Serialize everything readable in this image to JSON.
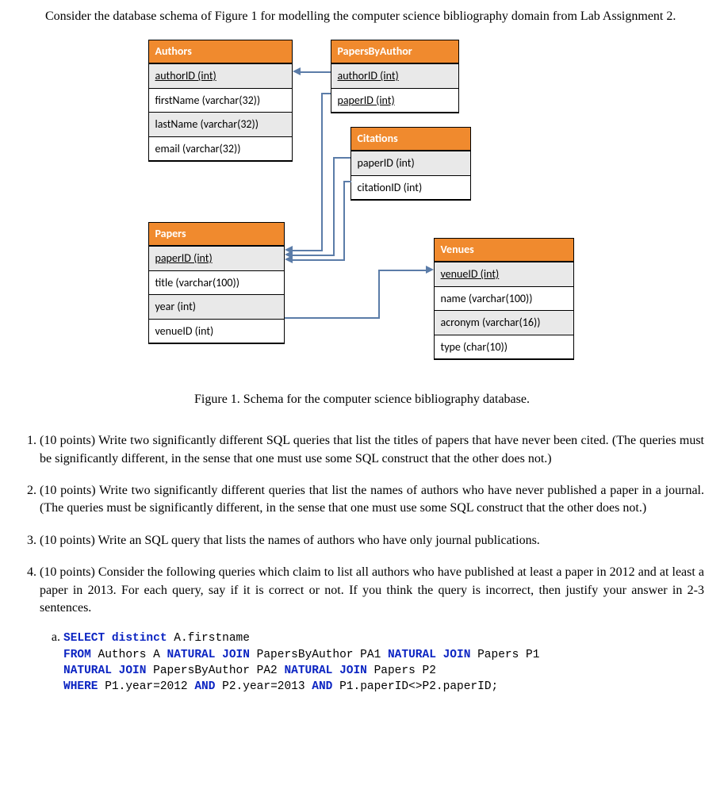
{
  "intro": "Consider the database schema of Figure 1 for modelling the computer science bibliography domain from Lab Assignment 2.",
  "schema": {
    "authors": {
      "title": "Authors",
      "cols": [
        "authorID (int)",
        "firstName (varchar(32))",
        "lastName (varchar(32))",
        "email (varchar(32))"
      ]
    },
    "papersByAuthor": {
      "title": "PapersByAuthor",
      "cols": [
        "authorID (int)",
        "paperID (int)"
      ]
    },
    "citations": {
      "title": "Citations",
      "cols": [
        "paperID (int)",
        "citationID (int)"
      ]
    },
    "papers": {
      "title": "Papers",
      "cols": [
        "paperID (int)",
        "title (varchar(100))",
        "year (int)",
        "venueID (int)"
      ]
    },
    "venues": {
      "title": "Venues",
      "cols": [
        "venueID (int)",
        "name (varchar(100))",
        "acronym (varchar(16))",
        "type (char(10))"
      ]
    }
  },
  "figure_caption": "Figure 1. Schema for the computer science bibliography database.",
  "questions": {
    "q1": "(10 points) Write two significantly different SQL queries that list the titles of papers that have never been cited. (The queries must be significantly different, in the sense that one must use some SQL construct that the other does not.)",
    "q2": "(10 points) Write two significantly different queries that list the names of authors who have never published a paper in a journal. (The queries must be significantly different, in the sense that one must use some SQL construct that the other does not.)",
    "q3": "(10 points) Write an SQL query that lists the names of authors who have only journal publications.",
    "q4": "(10 points) Consider the following queries which claim to list all authors who have published at least a paper in 2012 and at least a paper in 2013. For each query, say if it is correct or not. If you think the query is incorrect, then justify your answer in 2-3 sentences."
  },
  "sql": {
    "kw_select": "SELECT",
    "kw_distinct": "distinct",
    "ident_afn": " A.firstname",
    "kw_from": "FROM",
    "t_authors": " Authors A ",
    "kw_nj": "NATURAL JOIN",
    "t_pba1": " PapersByAuthor PA1 ",
    "t_p1": " Papers P1",
    "t_pba2": " PapersByAuthor PA2 ",
    "t_p2": " Papers P2",
    "kw_where": "WHERE",
    "cond1": " P1.year=2012 ",
    "kw_and": "AND",
    "cond2": " P2.year=2013 ",
    "cond3": " P1.paperID<>P2.paperID;"
  }
}
